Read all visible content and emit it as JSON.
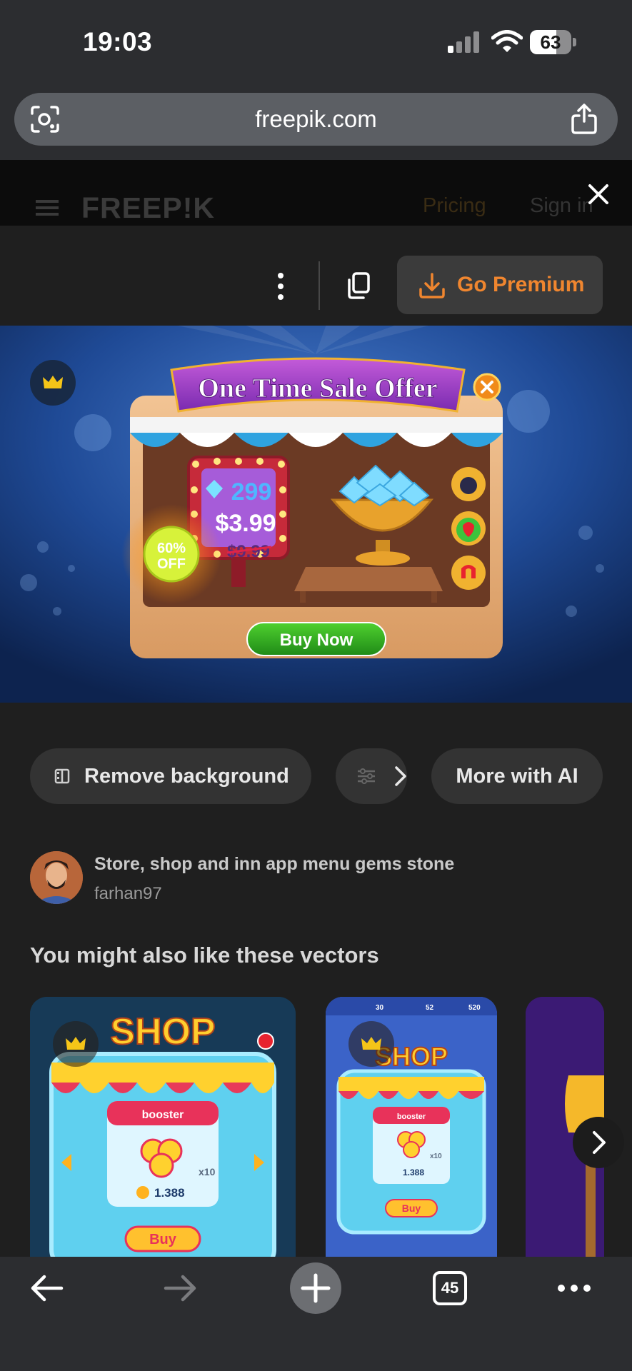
{
  "status_bar": {
    "time": "19:03",
    "battery_level": "63",
    "battery_fraction": 0.63
  },
  "browser": {
    "url": "freepik.com",
    "open_tabs": "45"
  },
  "site_header": {
    "logo": "FREEP!K",
    "pricing": "Pricing",
    "sign_in": "Sign in"
  },
  "actions": {
    "premium_label": "Go Premium"
  },
  "hero": {
    "banner_title": "One Time Sale Offer",
    "gem_count": "299",
    "price": "$3.99",
    "old_price": "$9.99",
    "discount_percent": "60%",
    "discount_word": "OFF",
    "buy_label": "Buy Now"
  },
  "ai_tools": {
    "remove_background": "Remove background",
    "more_with_ai": "More with AI"
  },
  "author": {
    "title": "Store, shop and inn app menu gems stone",
    "name": "farhan97"
  },
  "related": {
    "heading": "You might also like these vectors",
    "thumb1": {
      "title": "SHOP",
      "card": "booster",
      "count": "x10",
      "coins": "1.388",
      "buy": "Buy"
    },
    "thumb2": {
      "title": "SHOP",
      "card": "booster",
      "count": "x10",
      "coins": "1.388",
      "buy": "Buy",
      "stats": [
        "30",
        "52",
        "520"
      ]
    }
  },
  "colors": {
    "accent_orange": "#f0862f",
    "pill_bg": "#333333",
    "page_bg": "#1f1f1f"
  },
  "icons": [
    "lens-icon",
    "share-icon",
    "menu-icon",
    "close-icon",
    "more-vertical-icon",
    "copy-icon",
    "download-icon",
    "crown-icon",
    "remove-background-icon",
    "adjust-icon",
    "chevron-right-icon",
    "back-arrow-icon",
    "forward-arrow-icon",
    "plus-icon",
    "tabs-icon",
    "more-horizontal-icon"
  ]
}
